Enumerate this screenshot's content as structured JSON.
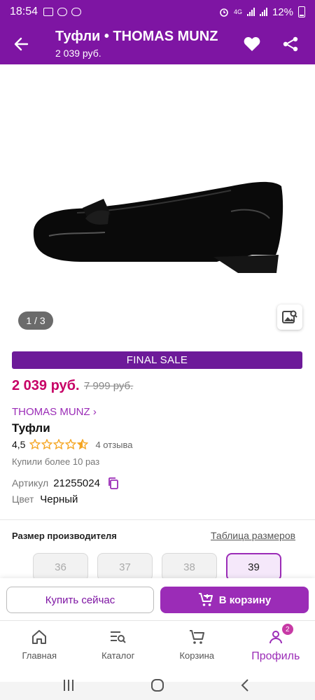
{
  "status_bar": {
    "time": "18:54",
    "network": "4G",
    "battery": "12%"
  },
  "header": {
    "title": "Туфли • THOMAS MUNZ",
    "price": "2 039 руб."
  },
  "gallery": {
    "counter": "1 / 3"
  },
  "product": {
    "banner": "FINAL SALE",
    "price": "2 039 руб.",
    "old_price": "7 999 руб.",
    "brand": "THOMAS MUNZ ›",
    "name": "Туфли",
    "rating": "4,5",
    "rating_value": 4.5,
    "reviews": "4 отзыва",
    "bought": "Купили более 10 раз",
    "article_label": "Артикул",
    "article": "21255024",
    "color_label": "Цвет",
    "color": "Черный"
  },
  "sizes": {
    "title": "Размер производителя",
    "table_link": "Таблица размеров",
    "options": [
      "36",
      "37",
      "38",
      "39"
    ],
    "selected": "39"
  },
  "actions": {
    "buy_now": "Купить сейчас",
    "to_cart": "В корзину"
  },
  "nav": {
    "items": [
      "Главная",
      "Каталог",
      "Корзина",
      "Профиль"
    ],
    "badge": "2"
  },
  "colors": {
    "brand_purple": "#7e15a3",
    "accent_purple": "#9b2cb7",
    "price_pink": "#c70066",
    "star": "#f5a623"
  }
}
